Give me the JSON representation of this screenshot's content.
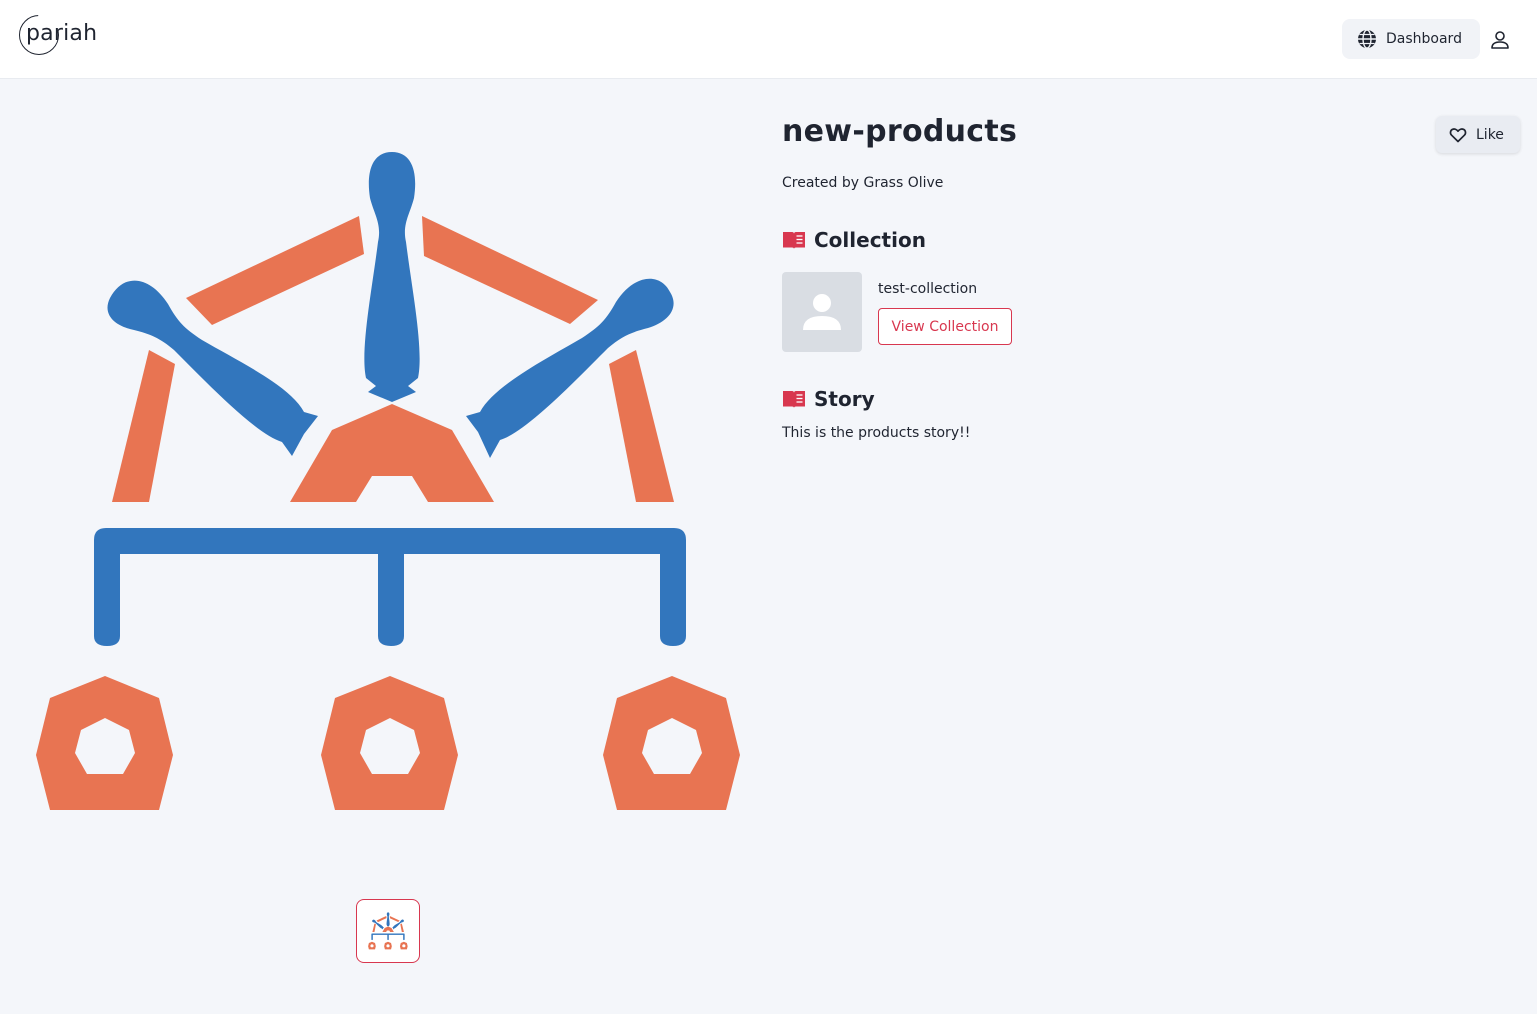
{
  "header": {
    "logo_text": "pariah",
    "dashboard_label": "Dashboard"
  },
  "product": {
    "title": "new-products",
    "creator": "Created by Grass Olive",
    "like_label": "Like"
  },
  "collection_section": {
    "heading": "Collection",
    "name": "test-collection",
    "view_button_label": "View Collection"
  },
  "story_section": {
    "heading": "Story",
    "text": "This is the products story!!"
  },
  "colors": {
    "accent": "#d8374f",
    "hero_blue": "#3276bd",
    "hero_orange": "#e87452",
    "background": "#f4f6fa"
  },
  "icons": {
    "dashboard": "globe-icon",
    "account": "user-icon",
    "like": "heart-icon",
    "section": "book-icon",
    "collection_placeholder": "person-placeholder-icon"
  }
}
